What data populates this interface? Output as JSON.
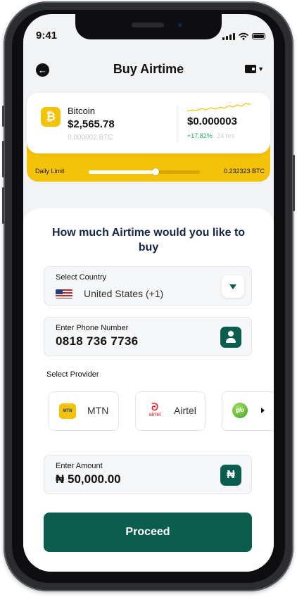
{
  "status_bar": {
    "time": "9:41"
  },
  "header": {
    "title": "Buy Airtime",
    "back_icon": "back-arrow-icon",
    "wallet_icon": "wallet-icon"
  },
  "coin": {
    "symbol_glyph": "₿",
    "name": "Bitcoin",
    "fiat_value": "$2,565.78",
    "crypto_amount": "0.000002 BTC",
    "unit_price": "$0.000003",
    "change": "+17.82%",
    "period": "24 hrs",
    "change_color": "#20b15a"
  },
  "daily_limit": {
    "label": "Daily Limit",
    "value": "0.232323 BTC",
    "progress_fraction": 0.6
  },
  "form": {
    "question": "How much Airtime would you like to buy",
    "country": {
      "label": "Select Country",
      "value": "United States (+1)"
    },
    "phone": {
      "label": "Enter Phone Number",
      "value": "0818 736 7736"
    },
    "provider_label": "Select Provider",
    "providers": [
      {
        "name": "MTN",
        "logo_text": "MTN"
      },
      {
        "name": "Airtel",
        "logo_text": "airtel"
      },
      {
        "name": "",
        "logo_text": "glo"
      }
    ],
    "amount": {
      "label": "Enter Amount",
      "value": "₦ 50,000.00",
      "currency_glyph": "₦"
    },
    "proceed_label": "Proceed"
  },
  "colors": {
    "accent_green": "#0b5e4e",
    "accent_yellow": "#f5c20a",
    "title_navy": "#14244a"
  }
}
